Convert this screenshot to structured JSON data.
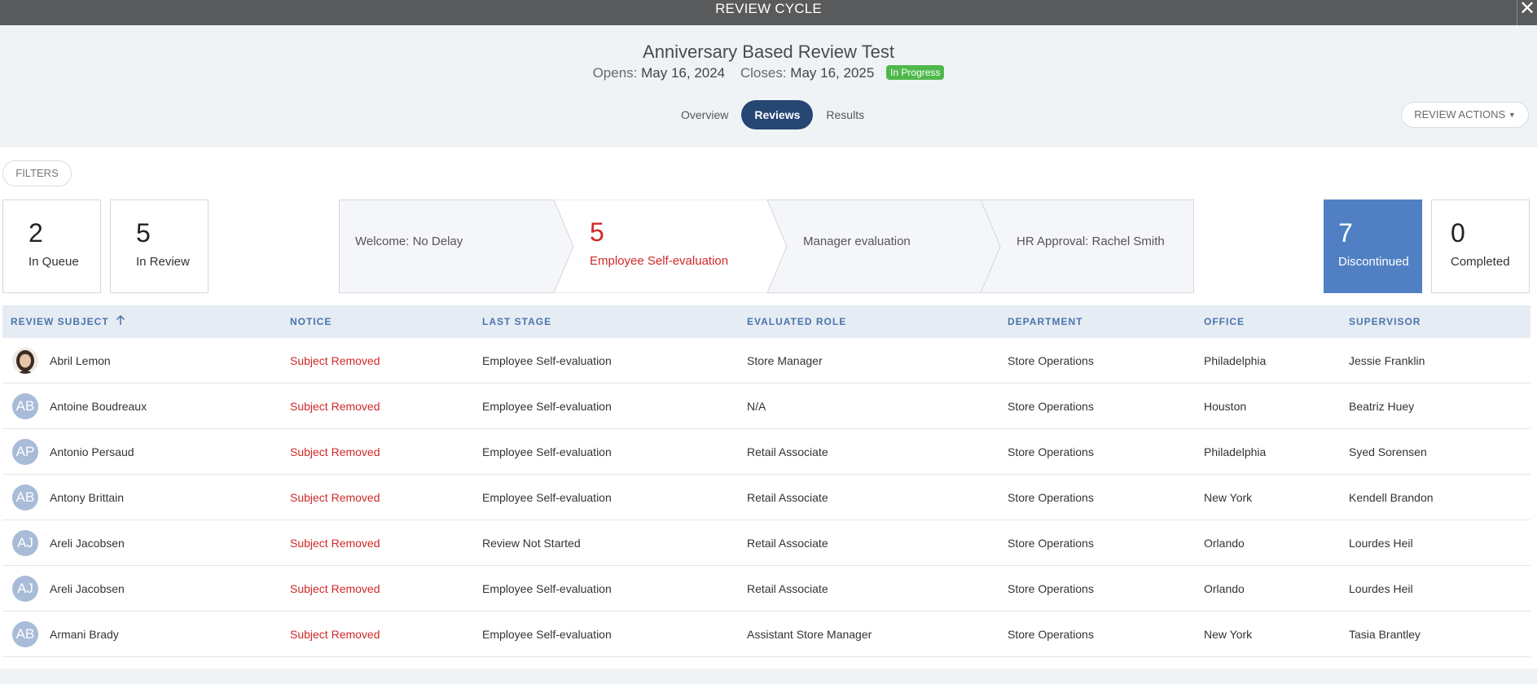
{
  "topbar": {
    "title": "REVIEW CYCLE",
    "close_icon": "close-icon"
  },
  "cycle": {
    "title": "Anniversary Based Review Test",
    "opens_label": "Opens:",
    "opens_date": "May 16, 2024",
    "closes_label": "Closes:",
    "closes_date": "May 16, 2025",
    "status": "In Progress"
  },
  "tabs": [
    {
      "label": "Overview",
      "active": false
    },
    {
      "label": "Reviews",
      "active": true
    },
    {
      "label": "Results",
      "active": false
    }
  ],
  "actions": {
    "label": "REVIEW ACTIONS"
  },
  "filters": {
    "label": "FILTERS"
  },
  "stats": {
    "in_queue": {
      "count": "2",
      "label": "In Queue"
    },
    "in_review": {
      "count": "5",
      "label": "In Review"
    },
    "discontinued": {
      "count": "7",
      "label": "Discontinued"
    },
    "completed": {
      "count": "0",
      "label": "Completed"
    }
  },
  "pipeline": {
    "stages": [
      {
        "label": "Welcome: No Delay",
        "count": ""
      },
      {
        "label": "Employee Self-evaluation",
        "count": "5"
      },
      {
        "label": "Manager evaluation",
        "count": ""
      },
      {
        "label": "HR Approval: Rachel Smith",
        "count": ""
      }
    ]
  },
  "table": {
    "columns": [
      "REVIEW SUBJECT",
      "NOTICE",
      "LAST STAGE",
      "EVALUATED ROLE",
      "DEPARTMENT",
      "OFFICE",
      "SUPERVISOR"
    ],
    "sort_icon": "sort-ascending-icon",
    "rows": [
      {
        "initials": "",
        "avatar": "photo",
        "subject": "Abril Lemon",
        "notice": "Subject Removed",
        "last_stage": "Employee Self-evaluation",
        "role": "Store Manager",
        "department": "Store Operations",
        "office": "Philadelphia",
        "supervisor": "Jessie Franklin"
      },
      {
        "initials": "AB",
        "avatar": "initials",
        "subject": "Antoine Boudreaux",
        "notice": "Subject Removed",
        "last_stage": "Employee Self-evaluation",
        "role": "N/A",
        "department": "Store Operations",
        "office": "Houston",
        "supervisor": "Beatriz Huey"
      },
      {
        "initials": "AP",
        "avatar": "initials",
        "subject": "Antonio Persaud",
        "notice": "Subject Removed",
        "last_stage": "Employee Self-evaluation",
        "role": "Retail Associate",
        "department": "Store Operations",
        "office": "Philadelphia",
        "supervisor": "Syed Sorensen"
      },
      {
        "initials": "AB",
        "avatar": "initials",
        "subject": "Antony Brittain",
        "notice": "Subject Removed",
        "last_stage": "Employee Self-evaluation",
        "role": "Retail Associate",
        "department": "Store Operations",
        "office": "New York",
        "supervisor": "Kendell Brandon"
      },
      {
        "initials": "AJ",
        "avatar": "initials",
        "subject": "Areli Jacobsen",
        "notice": "Subject Removed",
        "last_stage": "Review Not Started",
        "role": "Retail Associate",
        "department": "Store Operations",
        "office": "Orlando",
        "supervisor": "Lourdes Heil"
      },
      {
        "initials": "AJ",
        "avatar": "initials",
        "subject": "Areli Jacobsen",
        "notice": "Subject Removed",
        "last_stage": "Employee Self-evaluation",
        "role": "Retail Associate",
        "department": "Store Operations",
        "office": "Orlando",
        "supervisor": "Lourdes Heil"
      },
      {
        "initials": "AB",
        "avatar": "initials",
        "subject": "Armani Brady",
        "notice": "Subject Removed",
        "last_stage": "Employee Self-evaluation",
        "role": "Assistant Store Manager",
        "department": "Store Operations",
        "office": "New York",
        "supervisor": "Tasia Brantley"
      }
    ]
  },
  "colors": {
    "topbar": "#595a5c",
    "accent": "#264673",
    "status_green": "#4fb84c",
    "notice_red": "#d02828",
    "discontinued_blue": "#5080c3",
    "header_text": "#4a74ac"
  }
}
